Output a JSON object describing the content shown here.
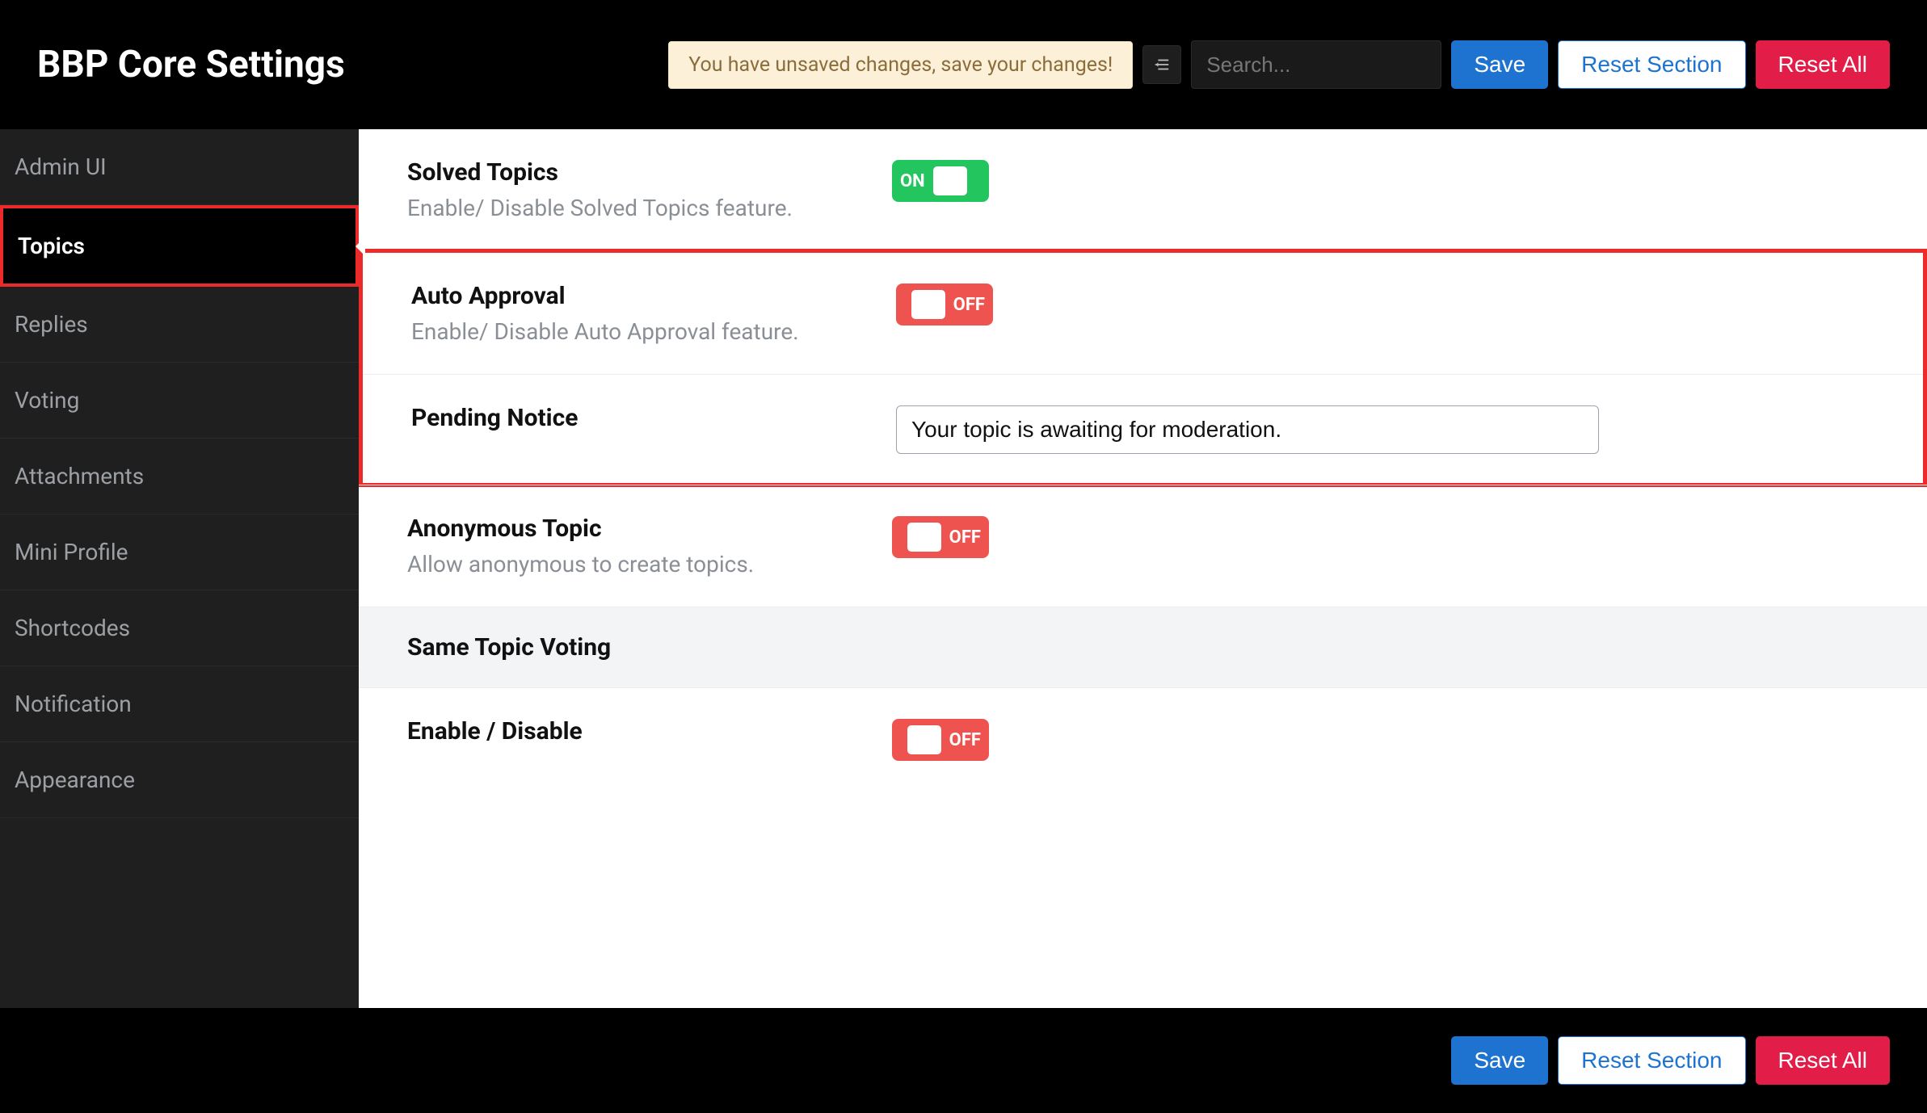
{
  "header": {
    "title": "BBP Core Settings",
    "unsaved_notice": "You have unsaved changes, save your changes!",
    "search_placeholder": "Search...",
    "save_label": "Save",
    "reset_section_label": "Reset Section",
    "reset_all_label": "Reset All"
  },
  "sidebar": {
    "items": [
      {
        "label": "Admin UI"
      },
      {
        "label": "Topics"
      },
      {
        "label": "Replies"
      },
      {
        "label": "Voting"
      },
      {
        "label": "Attachments"
      },
      {
        "label": "Mini Profile"
      },
      {
        "label": "Shortcodes"
      },
      {
        "label": "Notification"
      },
      {
        "label": "Appearance"
      }
    ],
    "active_index": 1
  },
  "toggle_labels": {
    "on": "ON",
    "off": "OFF"
  },
  "settings": {
    "solved_topics": {
      "title": "Solved Topics",
      "desc": "Enable/ Disable Solved Topics feature.",
      "state": "on"
    },
    "auto_approval": {
      "title": "Auto Approval",
      "desc": "Enable/ Disable Auto Approval feature.",
      "state": "off"
    },
    "pending_notice": {
      "title": "Pending Notice",
      "value": "Your topic is awaiting for moderation."
    },
    "anonymous_topic": {
      "title": "Anonymous Topic",
      "desc": "Allow anonymous to create topics.",
      "state": "off"
    },
    "same_topic_voting_heading": "Same Topic Voting",
    "same_topic_voting_enable": {
      "title": "Enable / Disable",
      "state": "off"
    }
  },
  "footer": {
    "save_label": "Save",
    "reset_section_label": "Reset Section",
    "reset_all_label": "Reset All"
  }
}
